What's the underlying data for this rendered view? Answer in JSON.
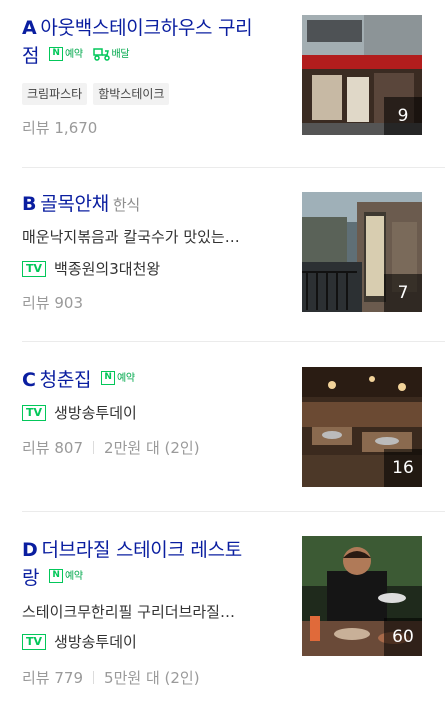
{
  "restaurants": [
    {
      "letter": "A",
      "name_line1": "아웃백스테이크하우스 구리",
      "name_line2": "점",
      "badge_n": "N",
      "reserve_label": "예약",
      "delivery_label": "배달",
      "tags": [
        "크림파스타",
        "함박스테이크"
      ],
      "review_label": "리뷰",
      "review_count": "1,670",
      "photo_count": "9"
    },
    {
      "letter": "B",
      "name": "골목안채",
      "category": "한식",
      "description": "매운낙지볶음과 칼국수가 맛있는…",
      "tv_label": "TV",
      "tv_show": "백종원의3대천왕",
      "review_label": "리뷰",
      "review_count": "903",
      "photo_count": "7"
    },
    {
      "letter": "C",
      "name": "청춘집",
      "badge_n": "N",
      "reserve_label": "예약",
      "tv_label": "TV",
      "tv_show": "생방송투데이",
      "review_label": "리뷰",
      "review_count": "807",
      "price": "2만원 대 (2인)",
      "photo_count": "16"
    },
    {
      "letter": "D",
      "name_line1": "더브라질 스테이크 레스토",
      "name_line2": "랑",
      "badge_n": "N",
      "reserve_label": "예약",
      "description": "스테이크무한리필 구리더브라질…",
      "tv_label": "TV",
      "tv_show": "생방송투데이",
      "review_label": "리뷰",
      "review_count": "779",
      "price": "5만원 대 (2인)",
      "photo_count": "60"
    }
  ],
  "colors": {
    "title": "#0a1ea0",
    "naver_green": "#03c75a",
    "meta_gray": "#9a9a9a"
  }
}
